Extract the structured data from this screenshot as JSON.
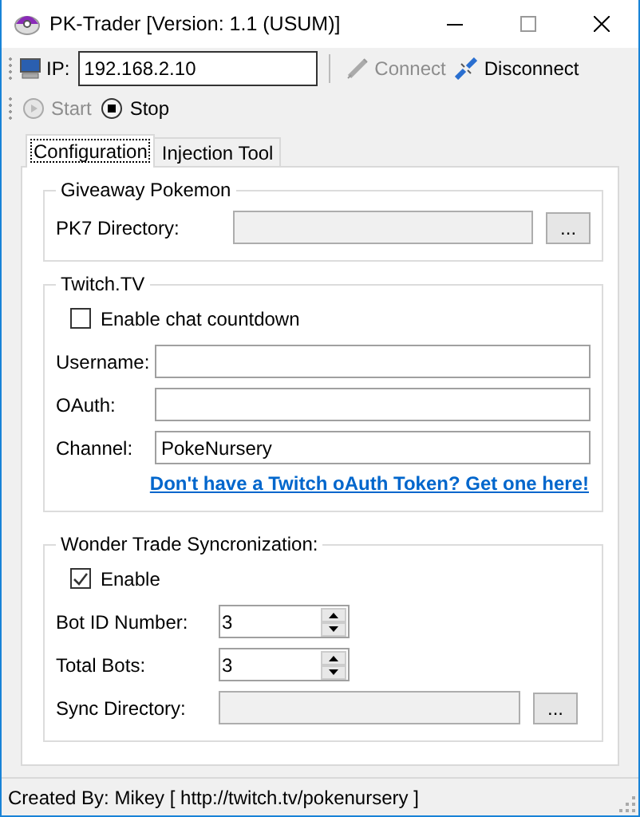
{
  "window": {
    "title": "PK-Trader [Version: 1.1 (USUM)]"
  },
  "connection": {
    "label": "IP:",
    "value": "192.168.2.10"
  },
  "toolbar": [
    {
      "kind": "connect",
      "label": "Connect",
      "disabled": true
    },
    {
      "kind": "disconnect",
      "label": "Disconnect",
      "disabled": false
    }
  ],
  "controls": [
    {
      "kind": "start",
      "label": "Start",
      "disabled": true
    },
    {
      "kind": "stop",
      "label": "Stop",
      "disabled": false
    }
  ],
  "tabs": [
    {
      "label": "Configuration",
      "selected": true
    },
    {
      "label": "Injection Tool",
      "selected": false
    }
  ],
  "groups": [
    {
      "title": "Giveaway Pokemon",
      "rows": [
        {
          "kind": "path",
          "label": "PK7 Directory:",
          "button": "...",
          "disabled": true
        }
      ]
    },
    {
      "title": "Twitch.TV",
      "rows": [
        {
          "kind": "checkbox",
          "label": "Enable chat countdown",
          "checked": false
        },
        {
          "kind": "text",
          "label": "Username:"
        },
        {
          "kind": "text",
          "label": "OAuth:"
        },
        {
          "kind": "text",
          "label": "Channel:",
          "value": "PokeNursery"
        },
        {
          "kind": "link",
          "text": "Don't have a Twitch oAuth Token? Get one here!"
        }
      ]
    },
    {
      "title": "Wonder Trade Syncronization:",
      "rows": [
        {
          "kind": "checkbox",
          "label": "Enable",
          "checked": true
        },
        {
          "kind": "spinner",
          "label": "Bot ID Number:",
          "value": "3"
        },
        {
          "kind": "spinner",
          "label": "Total Bots:",
          "value": "3"
        },
        {
          "kind": "path",
          "label": "Sync Directory:",
          "button": "...",
          "disabled": true
        }
      ]
    }
  ],
  "status_bar": {
    "text": "Created By: Mikey [ http://twitch.tv/pokenursery ]"
  }
}
